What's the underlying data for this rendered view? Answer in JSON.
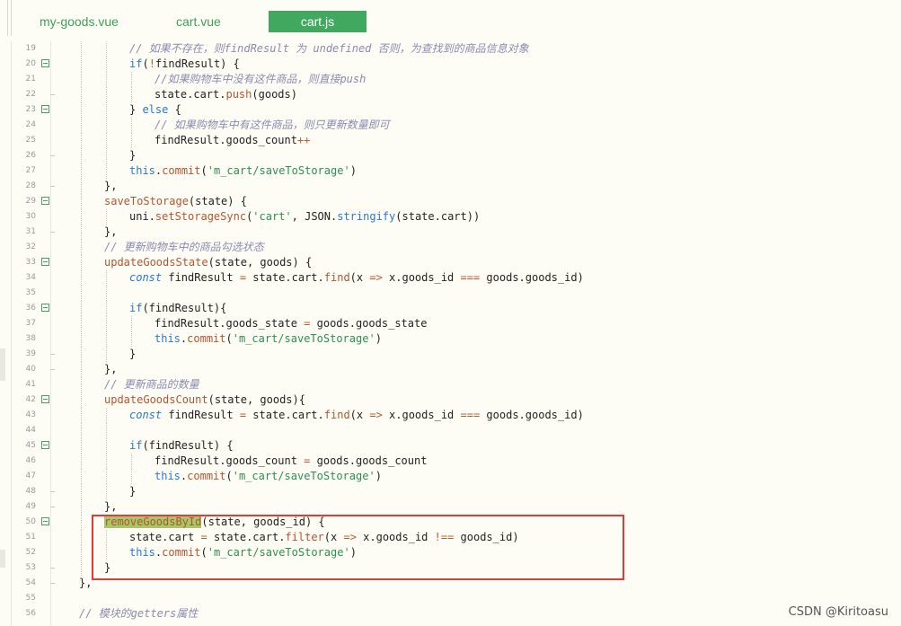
{
  "tabs": [
    {
      "label": "my-goods.vue",
      "active": false
    },
    {
      "label": "cart.vue",
      "active": false
    },
    {
      "label": "cart.js",
      "active": true
    }
  ],
  "colors": {
    "tab_active_bg": "#41a85f",
    "tab_text": "#3d9f57",
    "highlight_box": "#e43a3a",
    "selection_highlight": "#a7c86a"
  },
  "lines": [
    {
      "n": "19",
      "indent": 3,
      "fold": "",
      "tokens": [
        [
          "cmt",
          "// 如果不存在，则findResult 为 undefined 否则，为查找到的商品信息对象"
        ]
      ]
    },
    {
      "n": "20",
      "indent": 3,
      "fold": "open",
      "tokens": [
        [
          "kw",
          "if"
        ],
        [
          "pl",
          "("
        ],
        [
          "op",
          "!"
        ],
        [
          "pl",
          "findResult) {"
        ]
      ]
    },
    {
      "n": "21",
      "indent": 4,
      "fold": "",
      "tokens": [
        [
          "cmt",
          "//如果购物车中没有这件商品，则直接push"
        ]
      ]
    },
    {
      "n": "22",
      "indent": 4,
      "fold": "end",
      "tokens": [
        [
          "pl",
          "state.cart."
        ],
        [
          "fn",
          "push"
        ],
        [
          "pl",
          "(goods)"
        ]
      ]
    },
    {
      "n": "23",
      "indent": 3,
      "fold": "open",
      "tokens": [
        [
          "pl",
          "} "
        ],
        [
          "kw",
          "else"
        ],
        [
          "pl",
          " {"
        ]
      ]
    },
    {
      "n": "24",
      "indent": 4,
      "fold": "",
      "tokens": [
        [
          "cmt",
          "// 如果购物车中有这件商品，则只更新数量即可"
        ]
      ]
    },
    {
      "n": "25",
      "indent": 4,
      "fold": "",
      "tokens": [
        [
          "pl",
          "findResult.goods_count"
        ],
        [
          "op",
          "++"
        ]
      ]
    },
    {
      "n": "26",
      "indent": 3,
      "fold": "end",
      "tokens": [
        [
          "pl",
          "}"
        ]
      ]
    },
    {
      "n": "27",
      "indent": 3,
      "fold": "",
      "tokens": [
        [
          "kw",
          "this"
        ],
        [
          "pl",
          "."
        ],
        [
          "fn",
          "commit"
        ],
        [
          "pl",
          "("
        ],
        [
          "str",
          "'m_cart/saveToStorage'"
        ],
        [
          "pl",
          ")"
        ]
      ]
    },
    {
      "n": "28",
      "indent": 2,
      "fold": "end",
      "tokens": [
        [
          "pl",
          "},"
        ]
      ]
    },
    {
      "n": "29",
      "indent": 2,
      "fold": "open",
      "tokens": [
        [
          "fn",
          "saveToStorage"
        ],
        [
          "pl",
          "(state) {"
        ]
      ]
    },
    {
      "n": "30",
      "indent": 3,
      "fold": "",
      "tokens": [
        [
          "pl",
          "uni."
        ],
        [
          "fn",
          "setStorageSync"
        ],
        [
          "pl",
          "("
        ],
        [
          "str",
          "'cart'"
        ],
        [
          "pl",
          ", JSON."
        ],
        [
          "kw",
          "stringify"
        ],
        [
          "pl",
          "(state.cart))"
        ]
      ]
    },
    {
      "n": "31",
      "indent": 2,
      "fold": "end",
      "tokens": [
        [
          "pl",
          "},"
        ]
      ]
    },
    {
      "n": "32",
      "indent": 2,
      "fold": "",
      "tokens": [
        [
          "cmt",
          "// 更新购物车中的商品勾选状态"
        ]
      ]
    },
    {
      "n": "33",
      "indent": 2,
      "fold": "open",
      "tokens": [
        [
          "fn",
          "updateGoodsState"
        ],
        [
          "pl",
          "(state, goods) {"
        ]
      ]
    },
    {
      "n": "34",
      "indent": 3,
      "fold": "",
      "tokens": [
        [
          "kwi",
          "const"
        ],
        [
          "pl",
          " findResult "
        ],
        [
          "op",
          "="
        ],
        [
          "pl",
          " state.cart."
        ],
        [
          "fn",
          "find"
        ],
        [
          "pl",
          "(x "
        ],
        [
          "op",
          "=>"
        ],
        [
          "pl",
          " x.goods_id "
        ],
        [
          "op",
          "==="
        ],
        [
          "pl",
          " goods.goods_id)"
        ]
      ]
    },
    {
      "n": "35",
      "indent": 3,
      "fold": "",
      "tokens": []
    },
    {
      "n": "36",
      "indent": 3,
      "fold": "open",
      "tokens": [
        [
          "kw",
          "if"
        ],
        [
          "pl",
          "(findResult){"
        ]
      ]
    },
    {
      "n": "37",
      "indent": 4,
      "fold": "",
      "tokens": [
        [
          "pl",
          "findResult.goods_state "
        ],
        [
          "op",
          "="
        ],
        [
          "pl",
          " goods.goods_state"
        ]
      ]
    },
    {
      "n": "38",
      "indent": 4,
      "fold": "",
      "tokens": [
        [
          "kw",
          "this"
        ],
        [
          "pl",
          "."
        ],
        [
          "fn",
          "commit"
        ],
        [
          "pl",
          "("
        ],
        [
          "str",
          "'m_cart/saveToStorage'"
        ],
        [
          "pl",
          ")"
        ]
      ]
    },
    {
      "n": "39",
      "indent": 3,
      "fold": "end",
      "tokens": [
        [
          "pl",
          "}"
        ]
      ]
    },
    {
      "n": "40",
      "indent": 2,
      "fold": "end",
      "tokens": [
        [
          "pl",
          "},"
        ]
      ]
    },
    {
      "n": "41",
      "indent": 2,
      "fold": "",
      "tokens": [
        [
          "cmt",
          "// 更新商品的数量"
        ]
      ]
    },
    {
      "n": "42",
      "indent": 2,
      "fold": "open",
      "tokens": [
        [
          "fn",
          "updateGoodsCount"
        ],
        [
          "pl",
          "(state, goods){"
        ]
      ]
    },
    {
      "n": "43",
      "indent": 3,
      "fold": "",
      "tokens": [
        [
          "kwi",
          "const"
        ],
        [
          "pl",
          " findResult "
        ],
        [
          "op",
          "="
        ],
        [
          "pl",
          " state.cart."
        ],
        [
          "fn",
          "find"
        ],
        [
          "pl",
          "(x "
        ],
        [
          "op",
          "=>"
        ],
        [
          "pl",
          " x.goods_id "
        ],
        [
          "op",
          "==="
        ],
        [
          "pl",
          " goods.goods_id)"
        ]
      ]
    },
    {
      "n": "44",
      "indent": 3,
      "fold": "",
      "tokens": []
    },
    {
      "n": "45",
      "indent": 3,
      "fold": "open",
      "tokens": [
        [
          "kw",
          "if"
        ],
        [
          "pl",
          "(findResult) {"
        ]
      ]
    },
    {
      "n": "46",
      "indent": 4,
      "fold": "",
      "tokens": [
        [
          "pl",
          "findResult.goods_count "
        ],
        [
          "op",
          "="
        ],
        [
          "pl",
          " goods.goods_count"
        ]
      ]
    },
    {
      "n": "47",
      "indent": 4,
      "fold": "",
      "tokens": [
        [
          "kw",
          "this"
        ],
        [
          "pl",
          "."
        ],
        [
          "fn",
          "commit"
        ],
        [
          "pl",
          "("
        ],
        [
          "str",
          "'m_cart/saveToStorage'"
        ],
        [
          "pl",
          ")"
        ]
      ]
    },
    {
      "n": "48",
      "indent": 3,
      "fold": "end",
      "tokens": [
        [
          "pl",
          "}"
        ]
      ]
    },
    {
      "n": "49",
      "indent": 2,
      "fold": "end",
      "tokens": [
        [
          "pl",
          "},"
        ]
      ]
    },
    {
      "n": "50",
      "indent": 2,
      "fold": "open",
      "tokens": [
        [
          "fnhl",
          "removeGoodsById"
        ],
        [
          "pl",
          "(state, goods_id) {"
        ]
      ]
    },
    {
      "n": "51",
      "indent": 3,
      "fold": "",
      "tokens": [
        [
          "pl",
          "state.cart "
        ],
        [
          "op",
          "="
        ],
        [
          "pl",
          " state.cart."
        ],
        [
          "fn",
          "filter"
        ],
        [
          "pl",
          "(x "
        ],
        [
          "op",
          "=>"
        ],
        [
          "pl",
          " x.goods_id "
        ],
        [
          "op",
          "!=="
        ],
        [
          "pl",
          " goods_id)"
        ]
      ]
    },
    {
      "n": "52",
      "indent": 3,
      "fold": "",
      "tokens": [
        [
          "kw",
          "this"
        ],
        [
          "pl",
          "."
        ],
        [
          "fn",
          "commit"
        ],
        [
          "pl",
          "("
        ],
        [
          "str",
          "'m_cart/saveToStorage'"
        ],
        [
          "pl",
          ")"
        ]
      ]
    },
    {
      "n": "53",
      "indent": 2,
      "fold": "end",
      "tokens": [
        [
          "pl",
          "}"
        ]
      ]
    },
    {
      "n": "54",
      "indent": 1,
      "fold": "end",
      "tokens": [
        [
          "pl",
          "},"
        ]
      ]
    },
    {
      "n": "55",
      "indent": 1,
      "fold": "",
      "tokens": []
    },
    {
      "n": "56",
      "indent": 1,
      "fold": "",
      "tokens": [
        [
          "cmt",
          "// 模块的getters属性"
        ]
      ]
    }
  ],
  "watermark": "CSDN @Kiritoasu"
}
